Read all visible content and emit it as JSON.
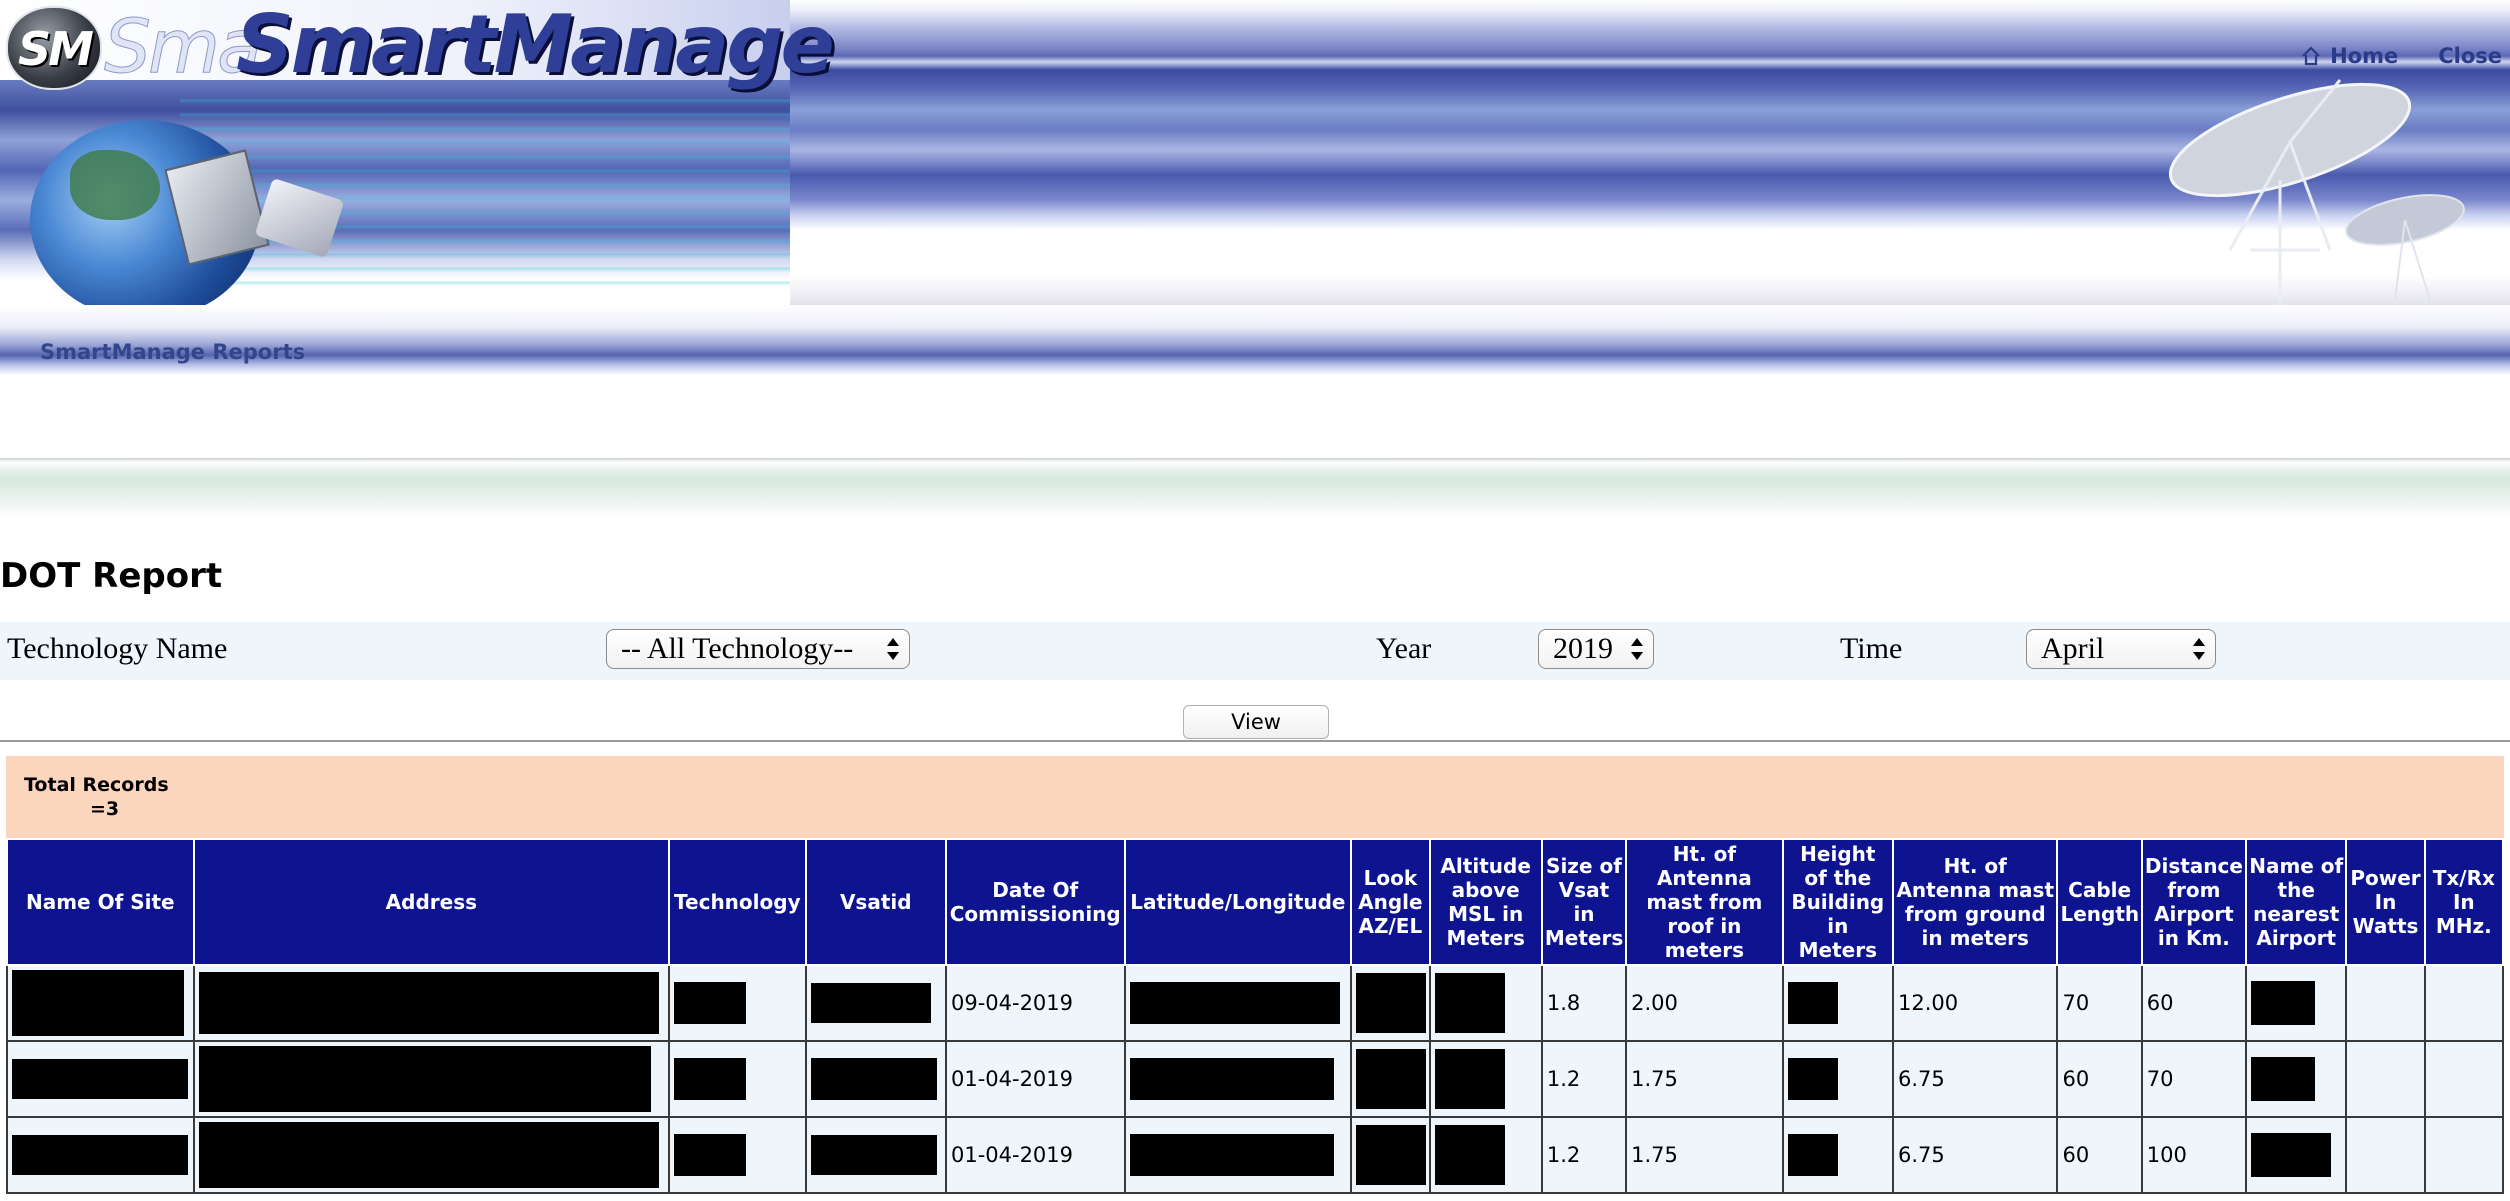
{
  "header": {
    "logo_badge": "SM",
    "logo_ghost": "Sma",
    "logo_title": "SmartManage",
    "nav": {
      "home": "Home",
      "close": "Close"
    },
    "reports_label": "SmartManage Reports"
  },
  "report": {
    "title": "DOT Report",
    "filters": {
      "technology_label": "Technology Name",
      "technology_value": "-- All Technology--",
      "year_label": "Year",
      "year_value": "2019",
      "time_label": "Time",
      "time_value": "April"
    },
    "view_button": "View",
    "total_records_line1": "Total Records",
    "total_records_line2": "=3"
  },
  "table": {
    "columns": [
      "Name Of Site",
      "Address",
      "Technology",
      "Vsatid",
      "Date Of Commissioning",
      "Latitude/Longitude",
      "Look Angle AZ/EL",
      "Altitude above MSL in Meters",
      "Size of Vsat in Meters",
      "Ht. of Antenna mast from roof in meters",
      "Height of the Building in Meters",
      "Ht. of Antenna mast from ground in meters",
      "Cable Length",
      "Distance from Airport in Km.",
      "Name of the nearest Airport",
      "Power In Watts",
      "Tx/Rx In MHz."
    ],
    "rows": [
      {
        "date": "09-04-2019",
        "size": "1.8",
        "roof": "2.00",
        "ground": "12.00",
        "cable": "70",
        "distance": "60"
      },
      {
        "date": "01-04-2019",
        "size": "1.2",
        "roof": "1.75",
        "ground": "6.75",
        "cable": "60",
        "distance": "70"
      },
      {
        "date": "01-04-2019",
        "size": "1.2",
        "roof": "1.75",
        "ground": "6.75",
        "cable": "60",
        "distance": "100"
      }
    ]
  }
}
